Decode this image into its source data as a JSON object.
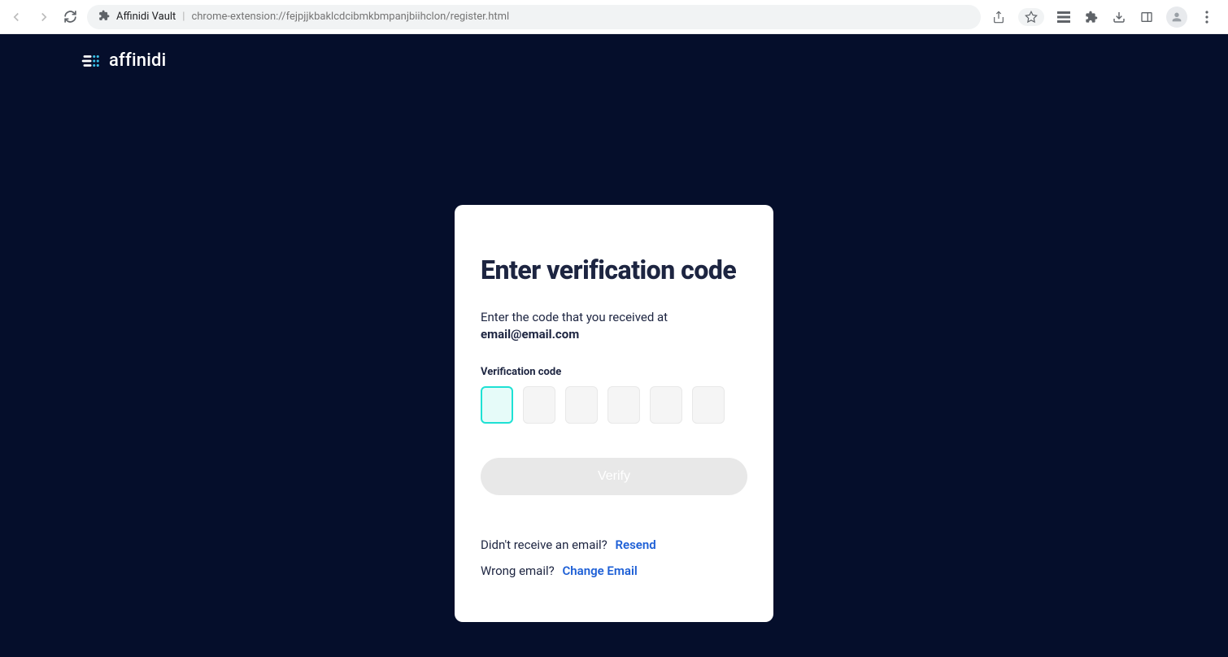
{
  "browser": {
    "site_name": "Affinidi Vault",
    "url_path": "chrome-extension://fejpjjkbaklcdcibmkbmpanjbiihclon/register.html"
  },
  "logo": {
    "text": "affinidi"
  },
  "card": {
    "title": "Enter verification code",
    "description_prefix": "Enter the code that you received at",
    "email": "email@email.com",
    "field_label": "Verification code",
    "verify_button": "Verify",
    "resend_prompt": "Didn't receive an email?",
    "resend_link": "Resend",
    "wrong_email_prompt": "Wrong email?",
    "change_email_link": "Change Email"
  }
}
